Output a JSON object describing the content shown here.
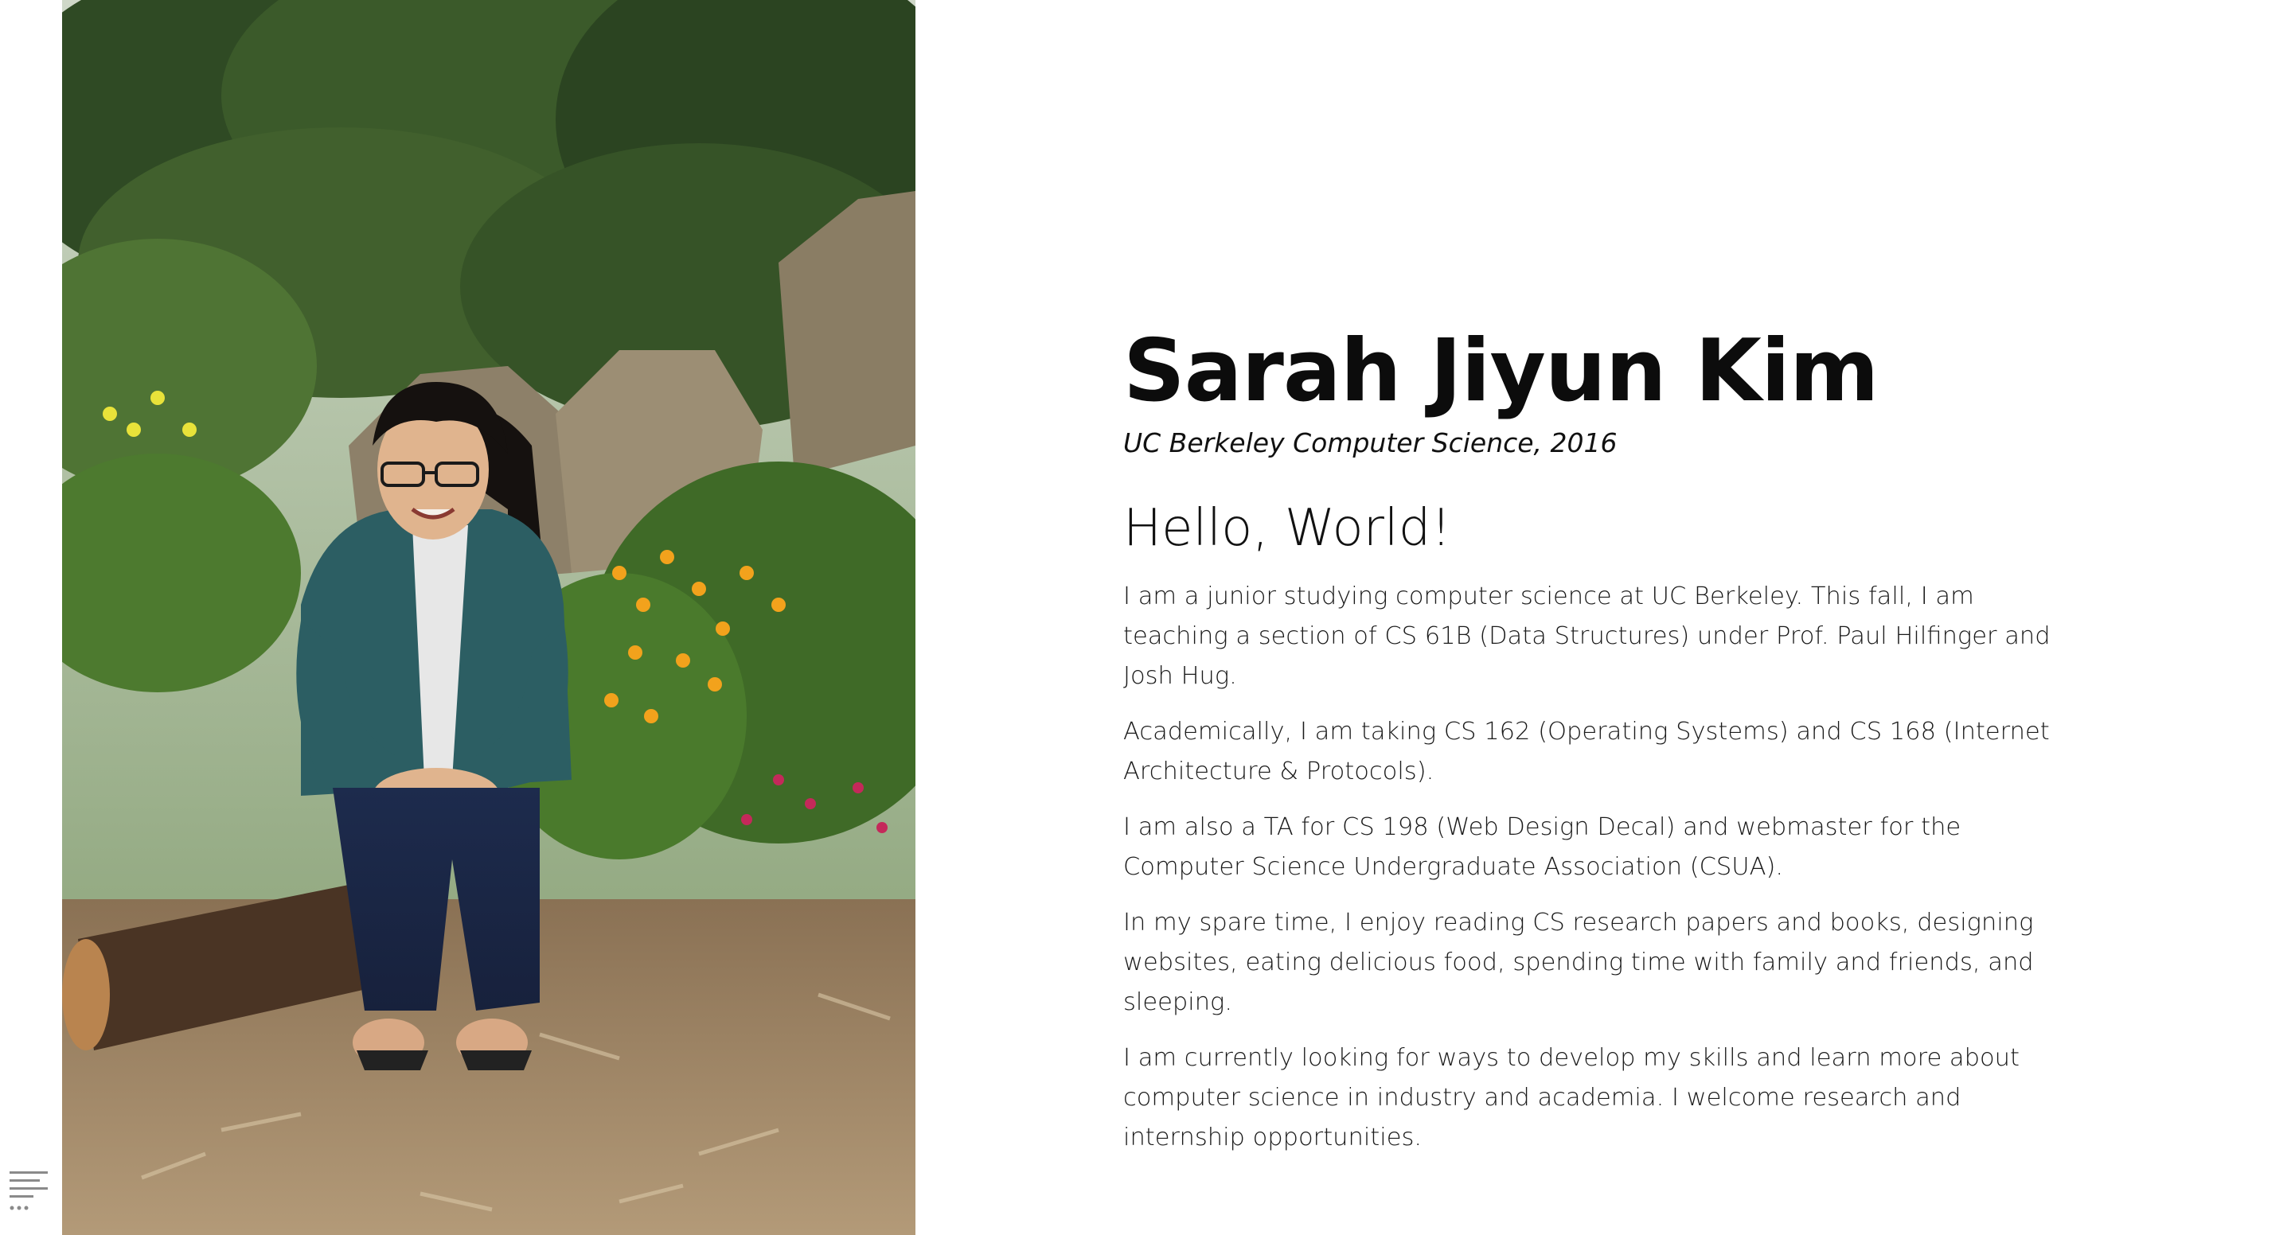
{
  "profile": {
    "name": "Sarah Jiyun Kim",
    "tagline": "UC Berkeley Computer Science, 2016",
    "greeting": "Hello, World!",
    "paragraphs": [
      "I am a junior studying computer science at UC Berkeley. This fall, I am teaching a section of CS 61B (Data Structures) under Prof. Paul Hilfinger and Josh Hug.",
      "Academically, I am taking CS 162 (Operating Systems) and CS 168 (Internet Architecture & Protocols).",
      "I am also a TA for CS 198 (Web Design Decal) and webmaster for the Computer Science Undergraduate Association (CSUA).",
      "In my spare time, I enjoy reading CS research papers and books, designing websites, eating delicious food, spending time with family and friends, and sleeping.",
      "I am currently looking for ways to develop my skills and learn more about computer science in industry and academia. I welcome research and internship opportunities."
    ]
  },
  "photo": {
    "subject": "portrait-photo"
  },
  "sidebar": {
    "menu_icon": "menu-lines-icon"
  },
  "colors": {
    "background": "#ffffff",
    "text": "#111111",
    "icon": "#8a8a8a"
  }
}
